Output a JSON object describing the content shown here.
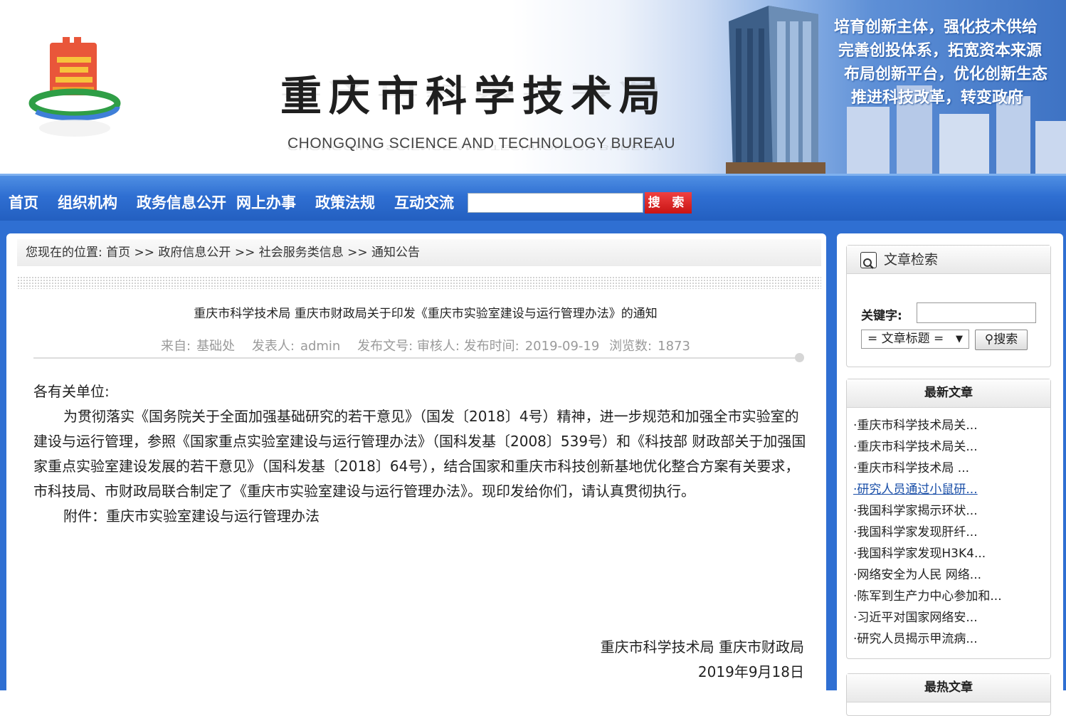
{
  "header": {
    "title_cn": "重庆市科学技术局",
    "title_en": "CHONGQING SCIENCE AND TECHNOLOGY BUREAU",
    "slogans": [
      "培育创新主体，强化技术供给",
      "完善创投体系，拓宽资本来源",
      "布局创新平台，优化创新生态",
      "推进科技改革，转变政府"
    ]
  },
  "nav": {
    "items": [
      "首页",
      "组织机构",
      "政务信息公开",
      "网上办事",
      "政策法规",
      "互动交流"
    ],
    "search_label": "搜 索",
    "search_value": ""
  },
  "breadcrumb": "您现在的位置: 首页 >> 政府信息公开 >> 社会服务类信息 >> 通知公告",
  "article": {
    "title": "重庆市科学技术局 重庆市财政局关于印发《重庆市实验室建设与运行管理办法》的通知",
    "meta": {
      "source_label": "来自:",
      "source": "基础处",
      "author_label": "发表人:",
      "author": "admin",
      "doc_label": "发布文号: 审核人: 发布时间:",
      "date": "2019-09-19",
      "views_label": "浏览数:",
      "views": "1873"
    },
    "salutation": "各有关单位:",
    "paragraph": "为贯彻落实《国务院关于全面加强基础研究的若干意见》（国发〔2018〕4号）精神，进一步规范和加强全市实验室的建设与运行管理，参照《国家重点实验室建设与运行管理办法》（国科发基〔2008〕539号）和《科技部 财政部关于加强国家重点实验室建设发展的若干意见》（国科发基〔2018〕64号），结合国家和重庆市科技创新基地优化整合方案有关要求，市科技局、市财政局联合制定了《重庆市实验室建设与运行管理办法》。现印发给你们，请认真贯彻执行。",
    "attachment": "附件：重庆市实验室建设与运行管理办法",
    "sign_org": "重庆市科学技术局 重庆市财政局",
    "sign_date": "2019年9月18日"
  },
  "sidebar": {
    "search": {
      "title": "文章检索",
      "keyword_label": "关键字:",
      "keyword_value": "",
      "select_value": "= 文章标题 =",
      "button": "搜索"
    },
    "latest": {
      "title": "最新文章",
      "items": [
        "·重庆市科学技术局关...",
        "·重庆市科学技术局关...",
        "·重庆市科学技术局 ...",
        "·研究人员通过小鼠研...",
        "·我国科学家揭示环状...",
        "·我国科学家发现肝纤...",
        "·我国科学家发现H3K4...",
        "·网络安全为人民 网络...",
        "·陈军到生产力中心参加和...",
        "·习近平对国家网络安...",
        "·研究人员揭示甲流病..."
      ]
    },
    "hot": {
      "title": "最热文章"
    }
  },
  "colors": {
    "nav_blue": "#2f6fd2",
    "search_red": "#d01818",
    "link_blue": "#1a4fa8"
  }
}
